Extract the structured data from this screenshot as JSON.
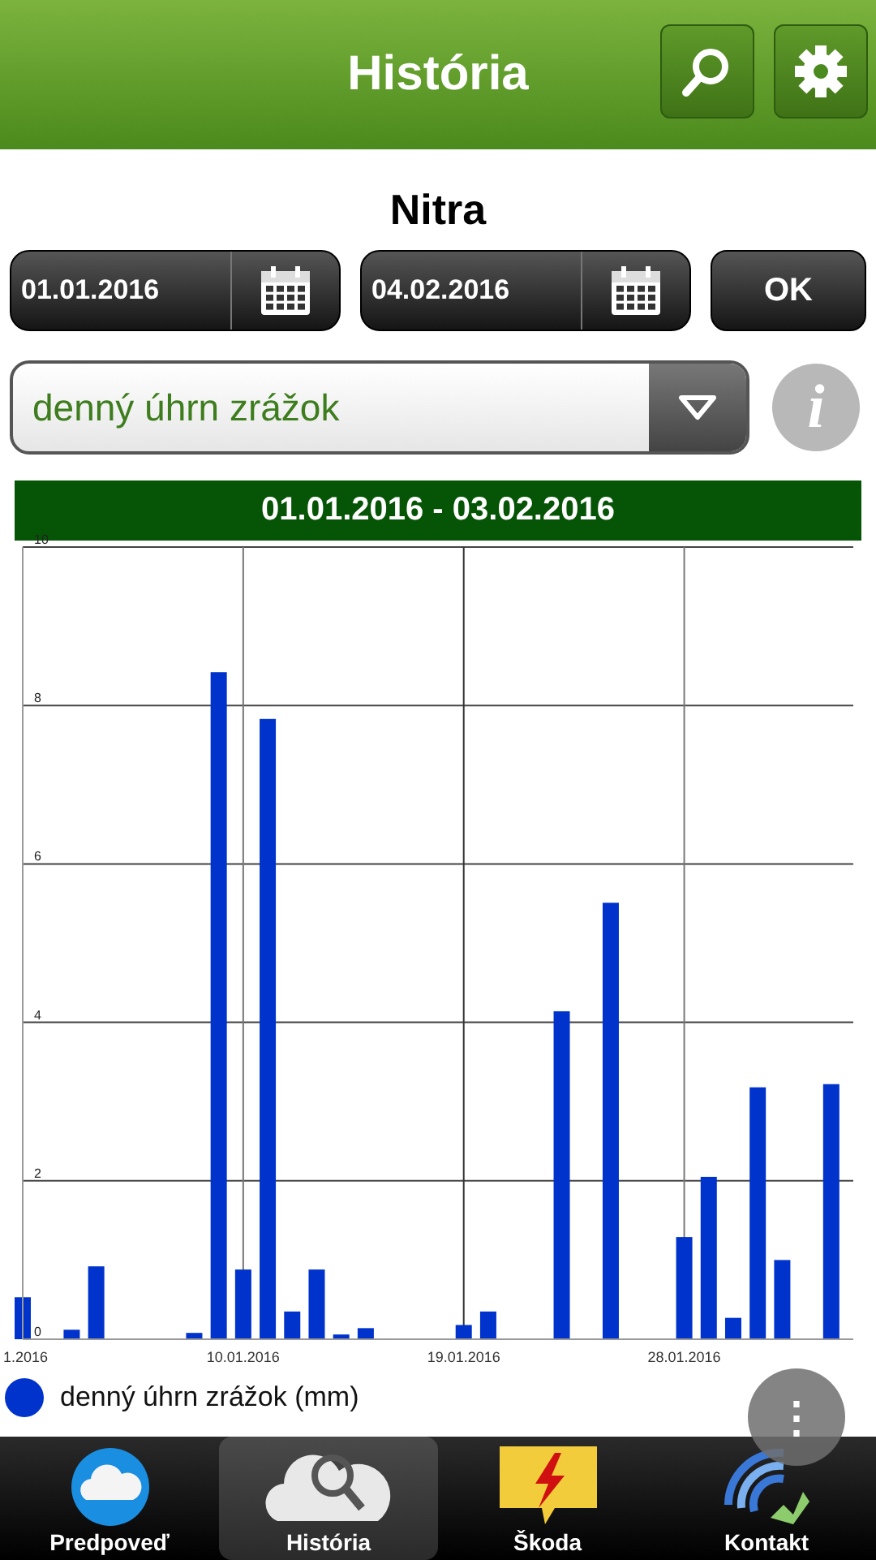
{
  "header": {
    "title": "História"
  },
  "location": "Nitra",
  "date_from": "01.01.2016",
  "date_to": "04.02.2016",
  "ok_button": "OK",
  "dropdown": {
    "value": "denný úhrn zrážok"
  },
  "info_button": "i",
  "range_banner": "01.01.2016 - 03.02.2016",
  "chart": {
    "chart_data": {
      "type": "bar",
      "categories": [
        "1.2016",
        null,
        null,
        null,
        null,
        null,
        null,
        null,
        null,
        "10.01.2016",
        null,
        null,
        null,
        null,
        null,
        null,
        null,
        null,
        "19.01.2016",
        null,
        null,
        null,
        null,
        null,
        null,
        null,
        null,
        "28.01.2016",
        null,
        null,
        null,
        null,
        null,
        null
      ],
      "series": [
        {
          "name": "denný úhrn zrážok (mm)",
          "color": "#0033cc",
          "values": [
            0.53,
            0,
            0.12,
            0.92,
            0,
            0,
            0,
            0.08,
            8.42,
            0.88,
            7.83,
            0.35,
            0.88,
            0.06,
            0.14,
            0,
            0,
            0,
            0.18,
            0.35,
            0,
            0,
            4.14,
            0,
            5.51,
            0,
            0,
            1.29,
            2.05,
            0.27,
            3.18,
            1.0,
            0,
            3.22
          ]
        }
      ],
      "ylim": [
        0,
        10
      ],
      "grid": true,
      "yticks": [
        0,
        2,
        4,
        6,
        8,
        10
      ]
    }
  },
  "more_button": "⋮",
  "nav": [
    {
      "label": "Predpoveď",
      "selected": false
    },
    {
      "label": "História",
      "selected": true
    },
    {
      "label": "Škoda",
      "selected": false
    },
    {
      "label": "Kontakt",
      "selected": false
    }
  ]
}
